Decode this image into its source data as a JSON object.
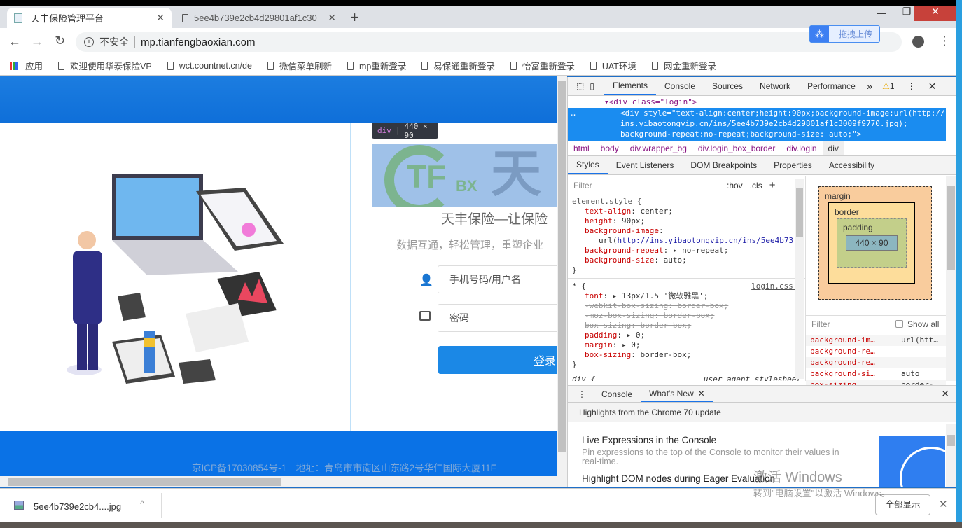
{
  "browser": {
    "tabs": [
      {
        "title": "天丰保险管理平台",
        "active": true
      },
      {
        "title": "5ee4b739e2cb4d29801af1c30",
        "active": false
      }
    ],
    "new_tab": "+",
    "security_label": "不安全",
    "url": "mp.tianfengbaoxian.com",
    "extension_label": "拖拽上传",
    "bookmarks": [
      "应用",
      "欢迎使用华泰保险VP",
      "wct.countnet.cn/de",
      "微信菜单刷新",
      "mp重新登录",
      "易保通重新登录",
      "怡富重新登录",
      "UAT环境",
      "网金重新登录"
    ]
  },
  "page": {
    "tooltip_tag": "div",
    "tooltip_size": "440 × 90",
    "logo_text": "TF",
    "logo_sub": "BX",
    "logo_cn": "天",
    "slogan": "天丰保险—让保险",
    "subtitle": "数据互通，轻松管理，重塑企业",
    "username_placeholder": "手机号码/用户名",
    "password_placeholder": "密码",
    "login_button": "登录",
    "footer": "京ICP备17030854号-1　地址：青岛市市南区山东路2号华仁国际大厦11F"
  },
  "devtools": {
    "tabs": [
      "Elements",
      "Console",
      "Sources",
      "Network",
      "Performance"
    ],
    "more": "»",
    "warning_count": "1",
    "dom": {
      "line1": "▾<div class=\"login\">",
      "sel1": "<div style=\"text-align:center;height:90px;background-image:url(http://",
      "sel2": "ins.yibaotongvip.cn/ins/5ee4b739e2cb4d29801af1c3009f9770.jpg);",
      "sel3": "background-repeat:no-repeat;background-size: auto;\">"
    },
    "breadcrumbs": [
      "html",
      "body",
      "div.wrapper_bg",
      "div.login_box_border",
      "div.login",
      "div"
    ],
    "subtabs": [
      "Styles",
      "Event Listeners",
      "DOM Breakpoints",
      "Properties",
      "Accessibility"
    ],
    "filter_placeholder": "Filter",
    "hov": ":hov",
    "cls": ".cls",
    "styles": {
      "element_selector": "element.style {",
      "rules": [
        [
          "text-align",
          "center;"
        ],
        [
          "height",
          "90px;"
        ],
        [
          "background-image",
          ""
        ]
      ],
      "url_text": "http://ins.yibaotongvip.cn/ins/5ee4b73",
      "rules2": [
        [
          "background-repeat",
          "▸ no-repeat;"
        ],
        [
          "background-size",
          "auto;"
        ]
      ],
      "close": "}",
      "star_selector": "* {",
      "source": "login.css:4",
      "font": "▸ 13px/1.5 '微软雅黑';",
      "struck": [
        "-webkit-box-sizing: border-box;",
        "-moz-box-sizing: border-box;",
        "box-sizing: border-box;"
      ],
      "rules3": [
        [
          "padding",
          "▸ 0;"
        ],
        [
          "margin",
          "▸ 0;"
        ],
        [
          "box-sizing",
          "border-box;"
        ]
      ],
      "div_selector": "div {",
      "ua": "user agent stylesheet"
    },
    "boxmodel": {
      "margin": "margin",
      "border": "border",
      "padding": "padding",
      "content": "440 × 90",
      "dash": "–"
    },
    "computed": {
      "filter": "Filter",
      "show_all": "Show all",
      "rows": [
        [
          "background-im…",
          "url(htt…"
        ],
        [
          "background-re…",
          ""
        ],
        [
          "background-re…",
          ""
        ],
        [
          "background-si…",
          "auto"
        ],
        [
          "box-sizing",
          "border-…"
        ]
      ]
    },
    "drawer": {
      "tabs": [
        "Console",
        "What's New"
      ],
      "header": "Highlights from the Chrome 70 update",
      "items": [
        {
          "title": "Live Expressions in the Console",
          "desc": "Pin expressions to the top of the Console to monitor their values in real-time."
        },
        {
          "title": "Highlight DOM nodes during Eager Evaluation",
          "desc": ""
        }
      ]
    }
  },
  "watermark": {
    "line1": "激活 Windows",
    "line2": "转到\"电脑设置\"以激活 Windows。"
  },
  "download": {
    "file": "5ee4b739e2cb4....jpg",
    "show_all": "全部显示"
  }
}
